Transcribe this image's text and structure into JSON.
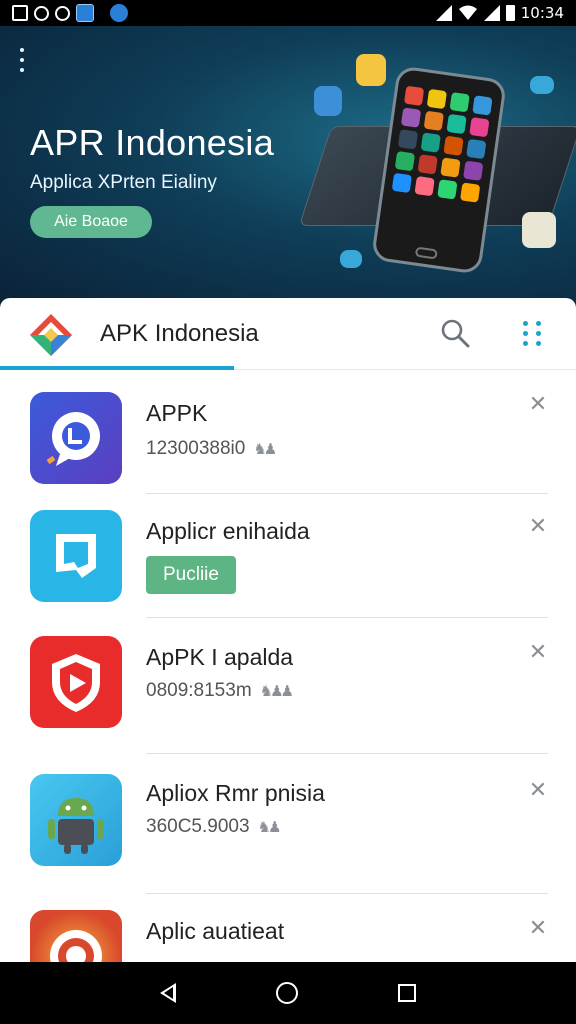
{
  "status_bar": {
    "time": "10:34"
  },
  "hero": {
    "title": "APR Indonesia",
    "subtitle": "Applica XPrten Eialiny",
    "button_label": "Aie Boaoe"
  },
  "appbar": {
    "title": "APK Indonesia"
  },
  "list": [
    {
      "title": "APPK",
      "subtitle": "12300388i0",
      "badge": "",
      "icon_color": "#3f53c9"
    },
    {
      "title": "Applicr enihaida",
      "subtitle": "",
      "badge": "Pucliie",
      "icon_color": "#29b5e6"
    },
    {
      "title": "ApPK I apalda",
      "subtitle": "0809:8153m",
      "badge": "",
      "icon_color": "#e82c2c"
    },
    {
      "title": "Apliox Rmr pnisia",
      "subtitle": "360C5.9003",
      "badge": "",
      "icon_color": "#34b6ea"
    },
    {
      "title": "Aplic auatieat",
      "subtitle": "",
      "badge": "",
      "icon_color": "#d9472c"
    }
  ],
  "icons": {
    "search": "search-icon",
    "more": "more-icon",
    "close": "close-icon",
    "back": "back-icon",
    "home": "home-icon",
    "recent": "recents-icon"
  }
}
